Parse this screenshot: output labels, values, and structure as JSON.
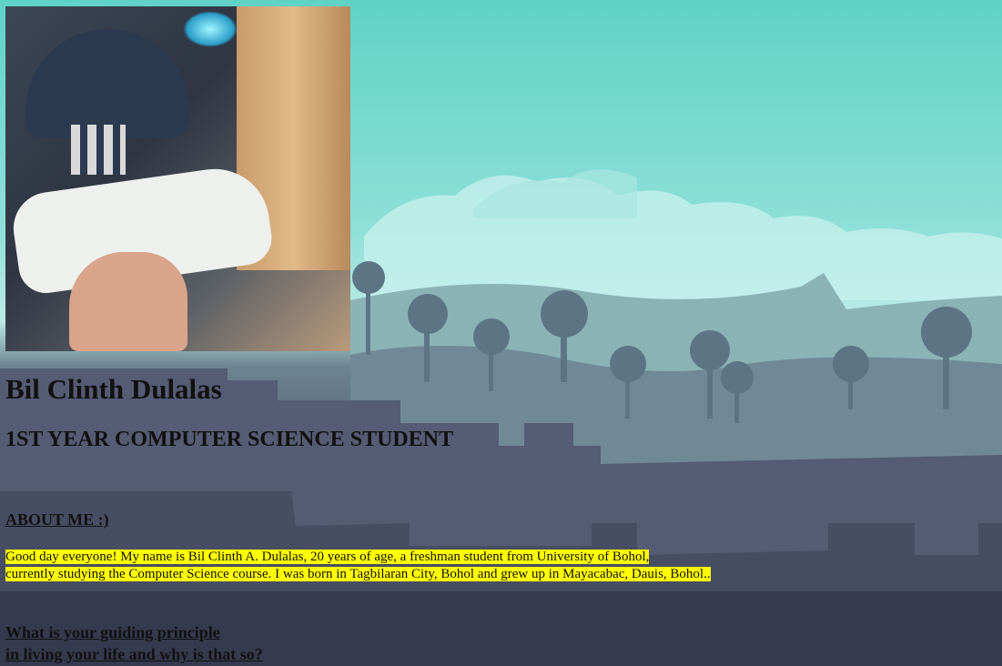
{
  "profile": {
    "photo_alt": "profile photo",
    "name": "Bil Clinth Dulalas",
    "role": "1ST YEAR COMPUTER SCIENCE STUDENT"
  },
  "about": {
    "title": "ABOUT ME :)",
    "line1": "Good day everyone! My name is Bil Clinth A. Dulalas, 20 years of age, a freshman student from University of Bohol,",
    "line2": "currently studying the Computer Science course. I was born in Tagbilaran City, Bohol and grew up in Mayacabac, Dauis, Bohol.."
  },
  "question": {
    "line1": "What is your guiding principle",
    "line2": "in living your life and why is that so?"
  },
  "colors": {
    "highlight": "#ffff00",
    "sky": "#5fd2c6",
    "ground": "#393f55"
  }
}
